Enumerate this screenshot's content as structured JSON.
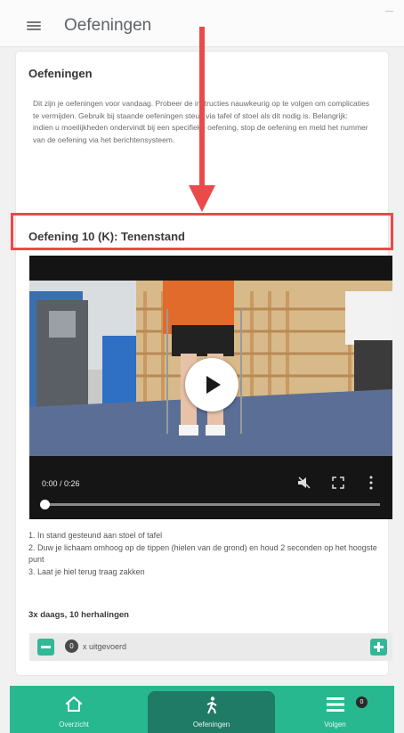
{
  "header": {
    "title": "Oefeningen",
    "status": "—"
  },
  "section": {
    "title": "Oefeningen",
    "intro": "Dit zijn je oefeningen voor vandaag. Probeer de instructies nauwkeurig op te volgen om complicaties te vermijden. Gebruik bij staande oefeningen steun via tafel of stoel als dit nodig is. Belangrijk: indien u moeilijkheden ondervindt bij een specifieke oefening, stop de oefening en meld het nummer van de oefening via het berichtensysteem."
  },
  "exercise": {
    "title": "Oefening 10 (K): Tenenstand",
    "video": {
      "time": "0:00 / 0:26",
      "progress": 0
    },
    "steps": [
      "1. In stand gesteund aan stoel of tafel",
      "2. Duw je lichaam omhoog op de tippen (hielen van de grond) en houd 2 seconden op het hoogste punt",
      "3. Laat je hiel terug traag zakken"
    ],
    "frequency": "3x daags, 10 herhalingen",
    "completed_count": "0",
    "completed_label": "x uitgevoerd"
  },
  "nav": {
    "items": [
      {
        "label": "Overzicht",
        "icon": "home-icon"
      },
      {
        "label": "Oefeningen",
        "icon": "walking-person-icon"
      },
      {
        "label": "Volgen",
        "icon": "list-icon"
      }
    ],
    "active_index": 1,
    "badge": "0"
  },
  "colors": {
    "accent": "#27b88f",
    "nav_active": "#1f7a66",
    "highlight": "#ea4a4a",
    "button": "#33b796"
  }
}
